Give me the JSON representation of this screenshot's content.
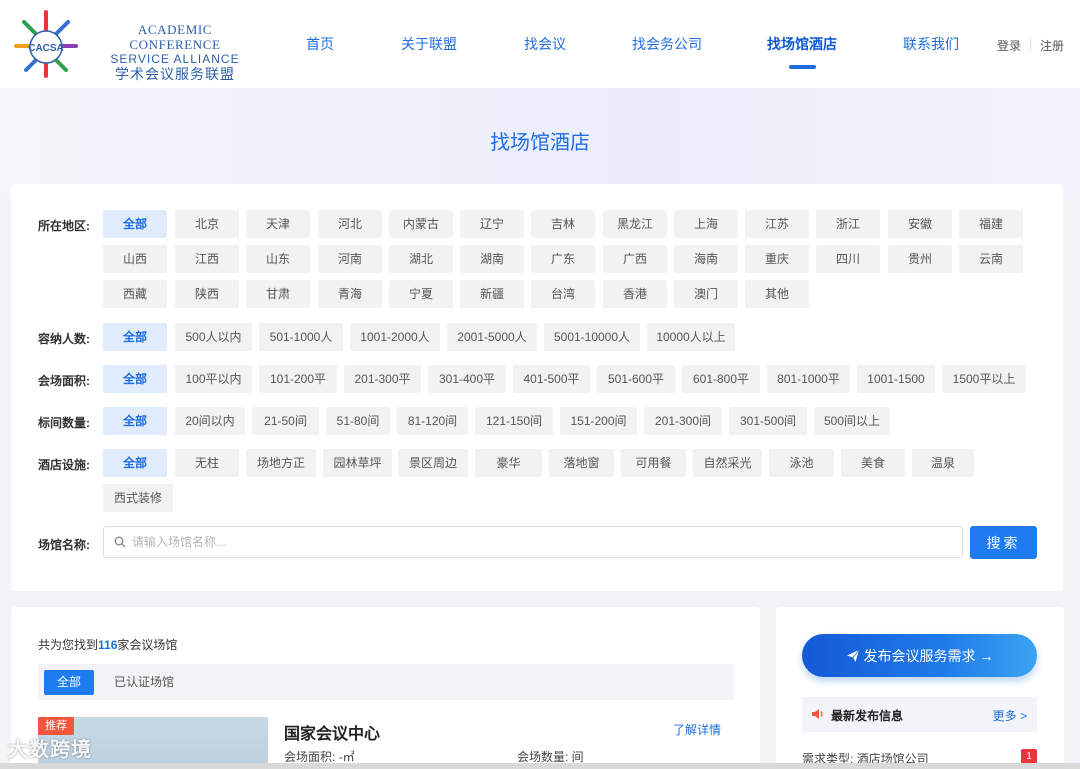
{
  "brand": {
    "logo_text": "CACSA",
    "en_line1": "ACADEMIC CONFERENCE",
    "en_line2": "SERVICE ALLIANCE",
    "cn": "学术会议服务联盟"
  },
  "nav": {
    "items": [
      {
        "label": "首页"
      },
      {
        "label": "关于联盟"
      },
      {
        "label": "找会议"
      },
      {
        "label": "找会务公司"
      },
      {
        "label": "找场馆酒店"
      },
      {
        "label": "联系我们"
      }
    ],
    "active_index": 4,
    "login": "登录",
    "register": "注册"
  },
  "page_title": "找场馆酒店",
  "filters": {
    "region": {
      "label": "所在地区:",
      "options": [
        "全部",
        "北京",
        "天津",
        "河北",
        "内蒙古",
        "辽宁",
        "吉林",
        "黑龙江",
        "上海",
        "江苏",
        "浙江",
        "安徽",
        "福建",
        "山西",
        "江西",
        "山东",
        "河南",
        "湖北",
        "湖南",
        "广东",
        "广西",
        "海南",
        "重庆",
        "四川",
        "贵州",
        "云南",
        "西藏",
        "陕西",
        "甘肃",
        "青海",
        "宁夏",
        "新疆",
        "台湾",
        "香港",
        "澳门",
        "其他"
      ]
    },
    "capacity": {
      "label": "容纳人数:",
      "options": [
        "全部",
        "500人以内",
        "501-1000人",
        "1001-2000人",
        "2001-5000人",
        "5001-10000人",
        "10000人以上"
      ]
    },
    "area": {
      "label": "会场面积:",
      "options": [
        "全部",
        "100平以内",
        "101-200平",
        "201-300平",
        "301-400平",
        "401-500平",
        "501-600平",
        "601-800平",
        "801-1000平",
        "1001-1500",
        "1500平以上"
      ]
    },
    "rooms": {
      "label": "标间数量:",
      "options": [
        "全部",
        "20间以内",
        "21-50间",
        "51-80间",
        "81-120间",
        "121-150间",
        "151-200间",
        "201-300间",
        "301-500间",
        "500间以上"
      ]
    },
    "facilities": {
      "label": "酒店设施:",
      "options": [
        "全部",
        "无柱",
        "场地方正",
        "园林草坪",
        "景区周边",
        "豪华",
        "落地窗",
        "可用餐",
        "自然采光",
        "泳池",
        "美食",
        "温泉",
        "西式装修"
      ]
    }
  },
  "search": {
    "label": "场馆名称:",
    "placeholder": "请输入场馆名称...",
    "value": "",
    "button": "搜索"
  },
  "results": {
    "count_prefix": "共为您找到",
    "count": "116",
    "count_suffix": "家会议场馆",
    "tabs": [
      {
        "label": "全部"
      },
      {
        "label": "已认证场馆"
      }
    ],
    "venue": {
      "badge": "推荐",
      "name": "国家会议中心",
      "detail_link": "了解详情",
      "area_text": "会场面积: -㎡",
      "count_text": "会场数量: 间"
    }
  },
  "sidebar": {
    "publish_button": "发布会议服务需求 →",
    "news_title": "最新发布信息",
    "news_more": "更多 >",
    "news_item": "需求类型:  酒店场馆公司",
    "news_badge": "1"
  },
  "watermark": "大数跨境",
  "colors": {
    "accent": "#1f6ee0",
    "button": "#1f7cf0",
    "badge_red": "#e8343a",
    "recommend": "#f2563c"
  }
}
